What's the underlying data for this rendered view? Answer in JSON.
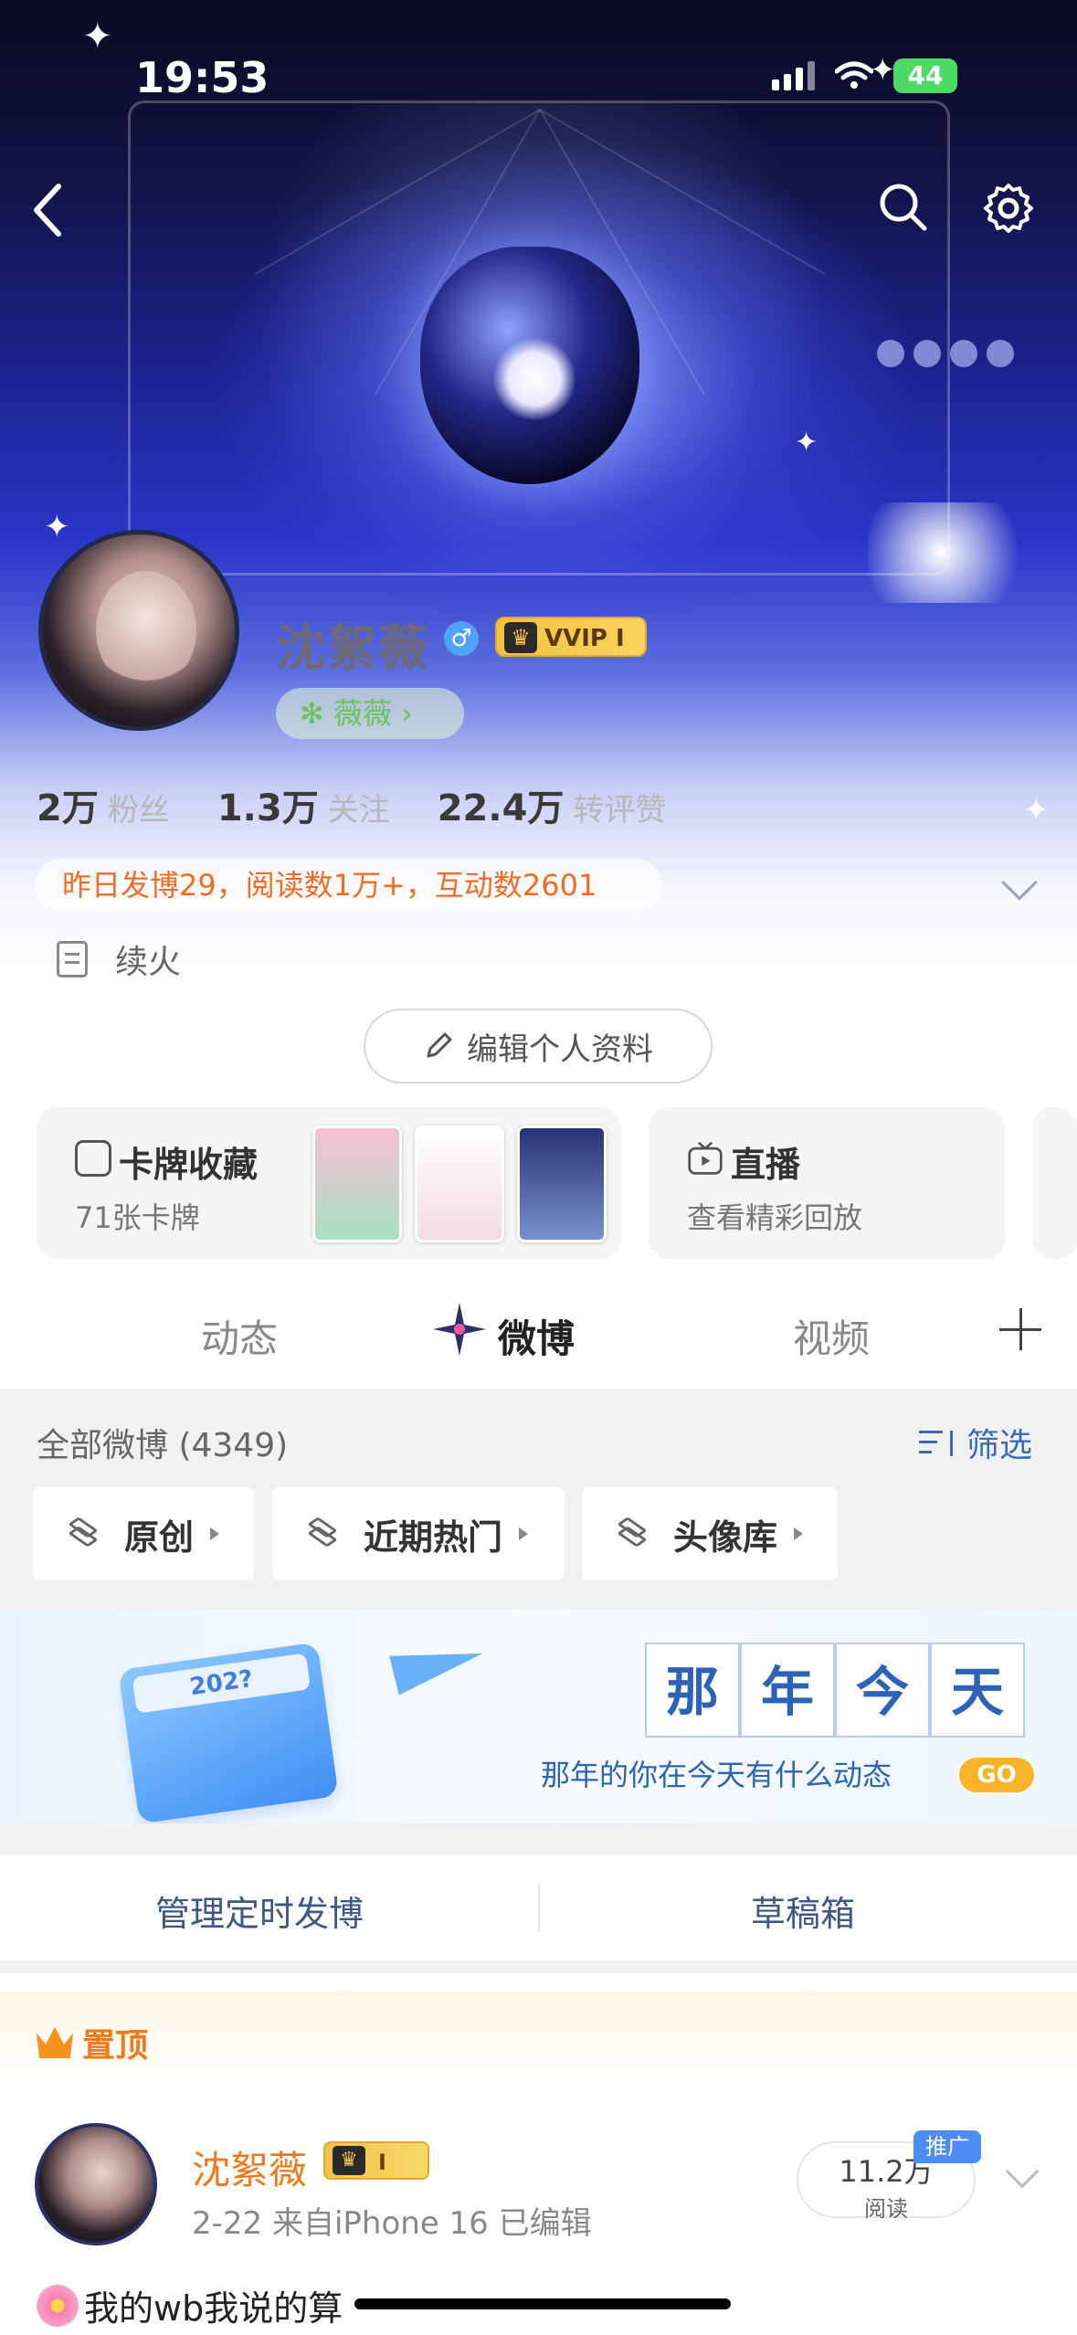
{
  "status_bar": {
    "time": "19:53",
    "battery": "44"
  },
  "profile": {
    "name": "沈絮薇",
    "gender": "♂",
    "vip_label": "VVIP I",
    "fan_group": "薇薇",
    "stats": [
      {
        "num": "2万",
        "label": "粉丝"
      },
      {
        "num": "1.3万",
        "label": "关注"
      },
      {
        "num": "22.4万",
        "label": "转评赞"
      }
    ],
    "yesterday": "昨日发博29，阅读数1万+，互动数2601",
    "bio": "续火",
    "edit_button": "编辑个人资料"
  },
  "cards": [
    {
      "title": "卡牌收藏",
      "sub": "71张卡牌"
    },
    {
      "title": "直播",
      "sub": "查看精彩回放"
    }
  ],
  "tabs": [
    {
      "label": "动态"
    },
    {
      "label": "微博"
    },
    {
      "label": "视频"
    }
  ],
  "feed": {
    "all_label": "全部微博 (4349)",
    "filter_label": "筛选",
    "chips": [
      "原创",
      "近期热门",
      "头像库"
    ]
  },
  "banner": {
    "calendar_year": "202?",
    "chars": [
      "那",
      "年",
      "今",
      "天"
    ],
    "subtitle": "那年的你在今天有什么动态",
    "go": "GO"
  },
  "manage": {
    "scheduled": "管理定时发博",
    "drafts": "草稿箱"
  },
  "pinned_post": {
    "pinned_label": "置顶",
    "name": "沈絮薇",
    "vip_level": "I",
    "meta": "2-22  来自iPhone 16  已编辑",
    "reads_num": "11.2万",
    "reads_label": "阅读",
    "promo": "推广",
    "text": "我的wb我说的算"
  },
  "colors": {
    "accent_orange": "#f07a1a",
    "link_blue": "#3a6ab8",
    "vip_gold": "#f5c040"
  }
}
